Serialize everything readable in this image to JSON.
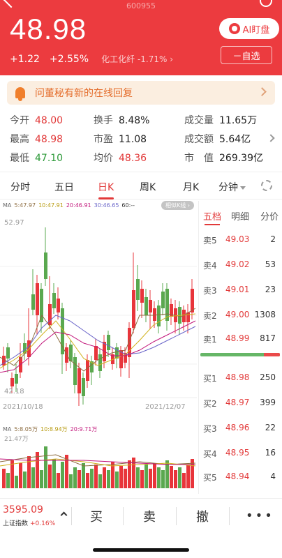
{
  "header": {
    "code": "600955",
    "price": "48.98",
    "change": "+1.22",
    "change_pct": "+2.55%",
    "sector": "化工化纤 -1.71% ›",
    "ai_label": "AI盯盘",
    "watch_label": "－自选"
  },
  "notice": {
    "text": "问董秘有新的在线回复"
  },
  "stats": {
    "open": {
      "label": "今开",
      "value": "48.00"
    },
    "high": {
      "label": "最高",
      "value": "48.98"
    },
    "low": {
      "label": "最低",
      "value": "47.10"
    },
    "turnover": {
      "label": "换手",
      "value": "8.48%"
    },
    "pe": {
      "label": "市盈",
      "value": "11.08"
    },
    "avg": {
      "label": "均价",
      "value": "48.36"
    },
    "volume": {
      "label": "成交量",
      "value": "11.65万"
    },
    "amount": {
      "label": "成交额",
      "value": "5.64亿"
    },
    "mcap": {
      "label": "市　值",
      "value": "269.39亿"
    }
  },
  "tabs": [
    "分时",
    "五日",
    "日K",
    "周K",
    "月K",
    "分钟"
  ],
  "chart": {
    "ma_legend": [
      "MA",
      "5:47.97",
      "10:47.91",
      "20:46.91",
      "30:46.65",
      "60:--"
    ],
    "similar_btn": "相似K线 ›",
    "y_high": "52.97",
    "y_low": "42.18",
    "date_start": "2021/10/18",
    "date_end": "2021/12/07",
    "vol_legend": [
      "MA",
      "5:8.05万",
      "10:8.94万",
      "20:9.71万"
    ],
    "vol_max": "21.47万",
    "colors": {
      "up": "#e8353b",
      "down": "#5aa84f",
      "ma5": "#8c6b3e",
      "ma10": "#d1b21e",
      "ma20": "#c2177b",
      "ma30": "#6a65c9"
    }
  },
  "orderbook": {
    "tabs": [
      "五档",
      "明细",
      "分价"
    ],
    "sell": [
      {
        "label": "卖5",
        "price": "49.03",
        "vol": "2"
      },
      {
        "label": "卖4",
        "price": "49.02",
        "vol": "53"
      },
      {
        "label": "卖3",
        "price": "49.01",
        "vol": "23"
      },
      {
        "label": "卖2",
        "price": "49.00",
        "vol": "1308"
      },
      {
        "label": "卖1",
        "price": "48.99",
        "vol": "817"
      }
    ],
    "buy": [
      {
        "label": "买1",
        "price": "48.98",
        "vol": "250"
      },
      {
        "label": "买2",
        "price": "48.97",
        "vol": "399"
      },
      {
        "label": "买3",
        "price": "48.96",
        "vol": "22"
      },
      {
        "label": "买4",
        "price": "48.95",
        "vol": "16"
      },
      {
        "label": "买5",
        "price": "48.94",
        "vol": "4"
      }
    ],
    "sell_ratio": 0.2
  },
  "bottom": {
    "index_value": "3595.09",
    "index_name": "上证指数",
    "index_change": "+0.16%",
    "actions": [
      "买",
      "卖",
      "撤"
    ],
    "more": "•••"
  }
}
